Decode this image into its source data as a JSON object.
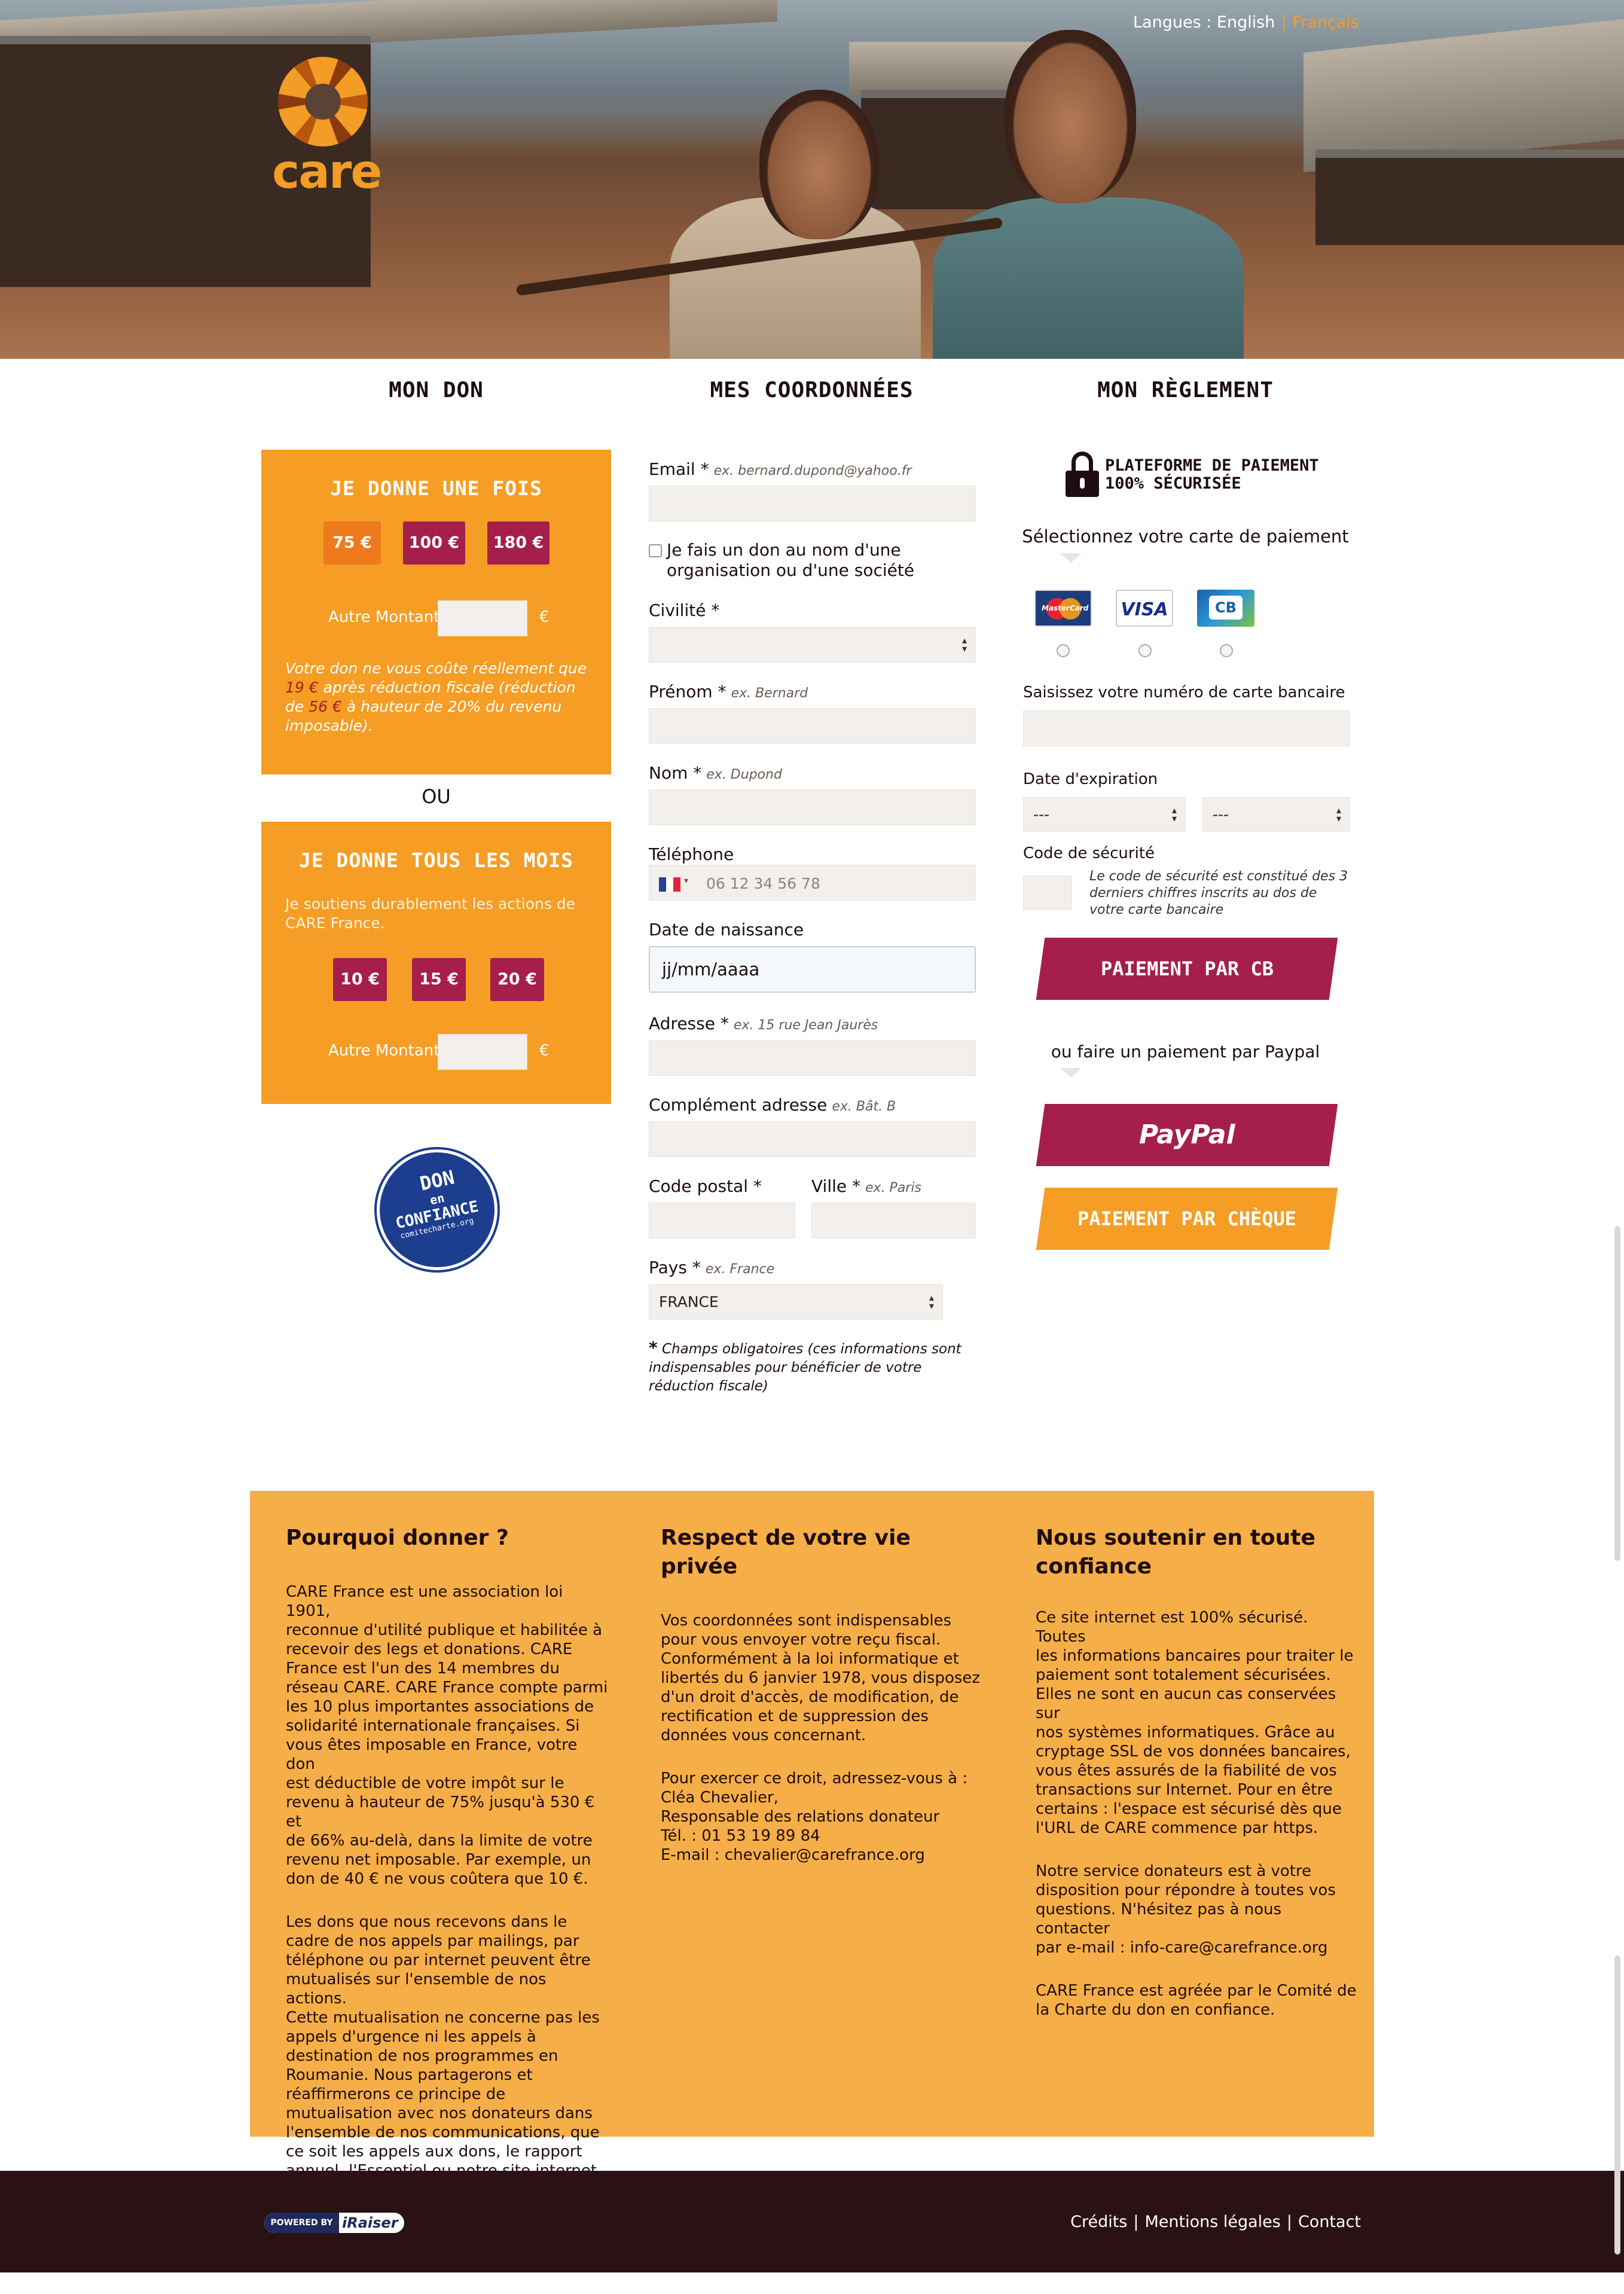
{
  "header": {
    "lang_label": "Langues :",
    "lang_english": "English",
    "lang_french": "Français",
    "logo_text": "care"
  },
  "columns": {
    "don": "MON DON",
    "coordonnees": "MES COORDONNÉES",
    "reglement": "MON RÈGLEMENT"
  },
  "don_once": {
    "title": "JE DONNE UNE FOIS",
    "amounts": [
      "75 €",
      "100 €",
      "180 €"
    ],
    "other_label": "Autre Montant",
    "currency": "€",
    "desc_1": "Votre don ne vous coûte réellement que",
    "desc_amount1": "19 €",
    "desc_2": "après réduction fiscale (réduction de",
    "desc_amount2": "56 €",
    "desc_3": "à hauteur de 20% du revenu imposable)."
  },
  "ou": "OU",
  "don_monthly": {
    "title": "JE DONNE TOUS LES MOIS",
    "desc": "Je soutiens durablement les actions de CARE France.",
    "amounts": [
      "10 €",
      "15 €",
      "20 €"
    ],
    "other_label": "Autre Montant",
    "currency": "€"
  },
  "badge": {
    "line1": "DON",
    "line2": "en",
    "line3": "CONFIANCE",
    "line4": "comitecharte.org"
  },
  "form": {
    "email_label": "Email *",
    "email_ex": "ex. bernard.dupond@yahoo.fr",
    "org_checkbox": "Je fais un don au nom d'une organisation ou d'une société",
    "civilite_label": "Civilité *",
    "prenom_label": "Prénom *",
    "prenom_ex": "ex. Bernard",
    "nom_label": "Nom *",
    "nom_ex": "ex. Dupond",
    "tel_label": "Téléphone",
    "tel_placeholder": "06 12 34 56 78",
    "dob_label": "Date de naissance",
    "dob_value": "jj/mm/aaaa",
    "adresse_label": "Adresse *",
    "adresse_ex": "ex. 15 rue Jean Jaurès",
    "complement_label": "Complément adresse",
    "complement_ex": "ex. Bât. B",
    "cp_label": "Code postal *",
    "ville_label": "Ville *",
    "ville_ex": "ex. Paris",
    "pays_label": "Pays *",
    "pays_ex": "ex. France",
    "pays_value": "FRANCE",
    "required_star": "*",
    "required_note": "Champs obligatoires (ces informations sont indispensables pour bénéficier de votre réduction fiscale)"
  },
  "payment": {
    "secure_line1": "PLATEFORME DE PAIEMENT",
    "secure_line2": "100% SÉCURISÉE",
    "select_card": "Sélectionnez votre carte de paiement",
    "card_mc": "MasterCard",
    "card_visa": "VISA",
    "card_cb": "CB",
    "card_number_label": "Saisissez votre numéro de carte bancaire",
    "expiry_label": "Date d'expiration",
    "expiry_month": "---",
    "expiry_year": "---",
    "cvv_label": "Code de sécurité",
    "cvv_help": "Le code de sécurité est constitué des 3 derniers chiffres inscrits au dos de votre carte bancaire",
    "pay_cb": "PAIEMENT PAR CB",
    "or_paypal": "ou faire un paiement par Paypal",
    "paypal": "PayPal",
    "pay_cheque": "PAIEMENT PAR CHÈQUE"
  },
  "info": {
    "col1_title": "Pourquoi donner ?",
    "col1_p1": "CARE France est une association loi 1901,\nreconnue d'utilité publique et habilitée à\nrecevoir des legs et donations. CARE\nFrance est l'un des 14 membres du\nréseau CARE. CARE France compte parmi\nles 10 plus importantes associations de\nsolidarité internationale françaises. Si\nvous êtes imposable en France, votre don\nest déductible de votre impôt sur le\nrevenu à hauteur de 75% jusqu'à 530 € et\nde 66% au-delà, dans la limite de votre\nrevenu net imposable. Par exemple, un\ndon de 40 € ne vous coûtera que 10 €.",
    "col1_p2": "Les dons que nous recevons dans le\ncadre de nos appels par mailings, par\ntéléphone ou par internet peuvent être\nmutualisés sur l'ensemble de nos actions.\nCette mutualisation ne concerne pas les\nappels d'urgence ni les appels à\ndestination de nos programmes en\nRoumanie. Nous partagerons et\nréaffirmerons ce principe de\nmutualisation avec nos donateurs dans\nl'ensemble de nos communications, que\nce soit les appels aux dons, le rapport\nannuel, l'Essentiel ou notre site internet.",
    "col2_title": "Respect de votre vie privée",
    "col2_p1": "Vos coordonnées sont indispensables\npour vous envoyer votre reçu fiscal.\nConformément à la loi informatique et\nlibertés du 6 janvier 1978, vous disposez\nd'un droit d'accès, de modification, de\nrectification et de suppression des\ndonnées vous concernant.",
    "col2_p2": "Pour exercer ce droit, adressez-vous à :\nCléa Chevalier,\nResponsable des relations donateur\nTél. : 01 53 19 89 84\nE-mail : chevalier@carefrance.org",
    "col3_title": "Nous soutenir en toute confiance",
    "col3_p1": "Ce site internet est 100% sécurisé. Toutes\nles informations bancaires pour traiter le\npaiement sont totalement sécurisées.\nElles ne sont en aucun cas conservées sur\nnos systèmes informatiques. Grâce au\ncryptage SSL de vos données bancaires,\nvous êtes assurés de la fiabilité de vos\ntransactions sur Internet. Pour en être\ncertains : l'espace est sécurisé dès que\nl'URL de CARE commence par https.",
    "col3_p2": "Notre service donateurs est à votre\ndisposition pour répondre à toutes vos\nquestions. N'hésitez pas à nous contacter\npar e-mail : info-care@carefrance.org",
    "col3_p3": "CARE France est agréée par le Comité de\nla Charte du don en confiance."
  },
  "footer": {
    "powered_by": "POWERED BY",
    "iraiser": "iRaiser",
    "credits": "Crédits",
    "mentions": "Mentions légales",
    "contact": "Contact"
  }
}
